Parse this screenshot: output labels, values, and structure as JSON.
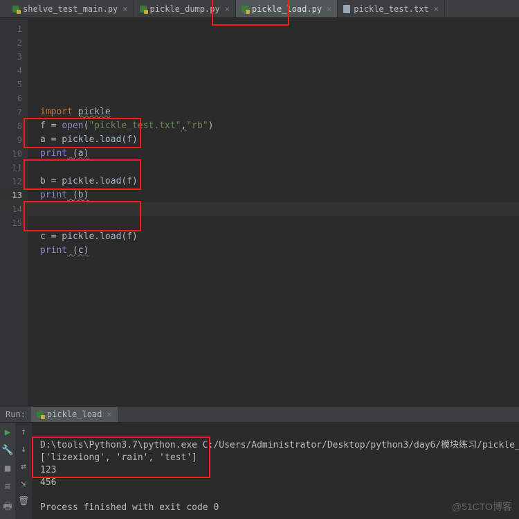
{
  "tabs": [
    {
      "label": "shelve_test_main.py",
      "type": "py",
      "active": false
    },
    {
      "label": "pickle_dump.py",
      "type": "py",
      "active": false
    },
    {
      "label": "pickle_load.py",
      "type": "py",
      "active": true
    },
    {
      "label": "pickle_test.txt",
      "type": "txt",
      "active": false
    }
  ],
  "gutter_lines": [
    "1",
    "2",
    "3",
    "4",
    "5",
    "6",
    "7",
    "8",
    "9",
    "10",
    "11",
    "12",
    "13",
    "14",
    "15"
  ],
  "code": {
    "l6_import": "import",
    "l6_pickle": "pickle",
    "l7": "f = open(\"pickle_test.txt\",\"rb\")",
    "l7_id": "f = ",
    "l7_open": "open",
    "l7_paren1": "(",
    "l7_str1": "\"pickle_test.txt\"",
    "l7_comma": ",",
    "l7_str2": "\"rb\"",
    "l7_paren2": ")",
    "l8": "a = pickle.load(f)",
    "l9_print": "print",
    "l9_rest": " (a)",
    "l11": "b = pickle.load(f)",
    "l12_print": "print",
    "l12_rest": " (b)",
    "l14": "c = pickle.load(f)",
    "l15_print": "print",
    "l15_rest": " (c)"
  },
  "run": {
    "label": "Run:",
    "tab_name": "pickle_load",
    "out1": "D:\\tools\\Python3.7\\python.exe C:/Users/Administrator/Desktop/python3/day6/模块练习/pickle_",
    "out2": "['lizexiong', 'rain', 'test']",
    "out3": "123",
    "out4": "456",
    "out5": "",
    "out6": "Process finished with exit code 0"
  },
  "watermark": "@51CTO博客"
}
